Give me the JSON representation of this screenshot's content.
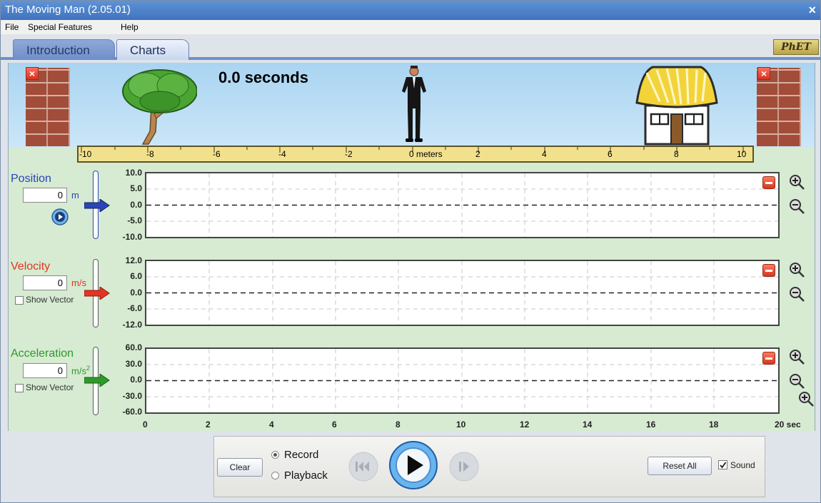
{
  "window": {
    "title": "The Moving Man (2.05.01)",
    "close_glyph": "×"
  },
  "menu": {
    "items": [
      "File",
      "Special Features",
      "Help"
    ]
  },
  "tabs": [
    {
      "label": "Introduction",
      "selected": false
    },
    {
      "label": "Charts",
      "selected": true
    }
  ],
  "logo": "PhET",
  "play_area": {
    "time_text": "0.0 seconds",
    "wall_close_glyph": "×",
    "ruler": {
      "ticks": [
        "-10",
        "-8",
        "-6",
        "-4",
        "-2",
        "0 meters",
        "2",
        "4",
        "6",
        "8",
        "10"
      ]
    }
  },
  "graphs": {
    "position": {
      "label": "Position",
      "value": "0",
      "unit": "m",
      "color": "#2a45b8",
      "y_ticks": [
        "10.0",
        "5.0",
        "0.0",
        "-5.0",
        "-10.0"
      ]
    },
    "velocity": {
      "label": "Velocity",
      "value": "0",
      "unit": "m/s",
      "color": "#e53421",
      "show_vector": "Show Vector",
      "y_ticks": [
        "12.0",
        "6.0",
        "0.0",
        "-6.0",
        "-12.0"
      ]
    },
    "acceleration": {
      "label": "Acceleration",
      "value": "0",
      "unit": "m/s",
      "unit_sup": "2",
      "color": "#2e9a2a",
      "show_vector": "Show Vector",
      "y_ticks": [
        "60.0",
        "30.0",
        "0.0",
        "-30.0",
        "-60.0"
      ]
    },
    "x_ticks": [
      "0",
      "2",
      "4",
      "6",
      "8",
      "10",
      "12",
      "14",
      "16",
      "18",
      "20 sec"
    ]
  },
  "controls": {
    "clear": "Clear",
    "record": "Record",
    "playback": "Playback",
    "mode_selected": "Record",
    "reset_all": "Reset All",
    "sound": "Sound",
    "sound_checked": true
  }
}
